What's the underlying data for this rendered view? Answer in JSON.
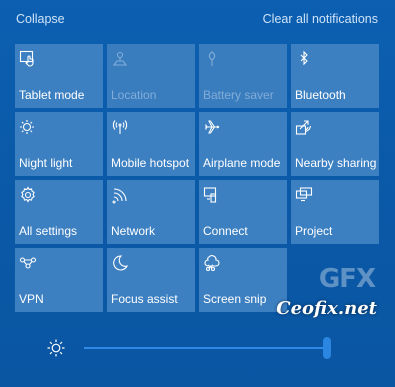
{
  "header": {
    "collapse_label": "Collapse",
    "clear_label": "Clear all notifications"
  },
  "tiles": [
    {
      "label": "Tablet mode",
      "icon": "tablet-mode-icon",
      "enabled": true
    },
    {
      "label": "Location",
      "icon": "location-icon",
      "enabled": false
    },
    {
      "label": "Battery saver",
      "icon": "battery-saver-icon",
      "enabled": false
    },
    {
      "label": "Bluetooth",
      "icon": "bluetooth-icon",
      "enabled": true
    },
    {
      "label": "Night light",
      "icon": "night-light-icon",
      "enabled": true
    },
    {
      "label": "Mobile hotspot",
      "icon": "mobile-hotspot-icon",
      "enabled": true
    },
    {
      "label": "Airplane mode",
      "icon": "airplane-icon",
      "enabled": true
    },
    {
      "label": "Nearby sharing",
      "icon": "nearby-sharing-icon",
      "enabled": true
    },
    {
      "label": "All settings",
      "icon": "gear-icon",
      "enabled": true
    },
    {
      "label": "Network",
      "icon": "network-icon",
      "enabled": true
    },
    {
      "label": "Connect",
      "icon": "connect-icon",
      "enabled": true
    },
    {
      "label": "Project",
      "icon": "project-icon",
      "enabled": true
    },
    {
      "label": "VPN",
      "icon": "vpn-icon",
      "enabled": true
    },
    {
      "label": "Focus assist",
      "icon": "moon-icon",
      "enabled": true
    },
    {
      "label": "Screen snip",
      "icon": "screen-snip-icon",
      "enabled": true
    }
  ],
  "brightness": {
    "icon": "brightness-icon",
    "level": 1.0
  },
  "watermark": {
    "logo": "GFX",
    "text": "Ceofix.net"
  },
  "colors": {
    "background": "#0b5aa8",
    "tile": "#3d80c2",
    "accent": "#2a86e0"
  }
}
